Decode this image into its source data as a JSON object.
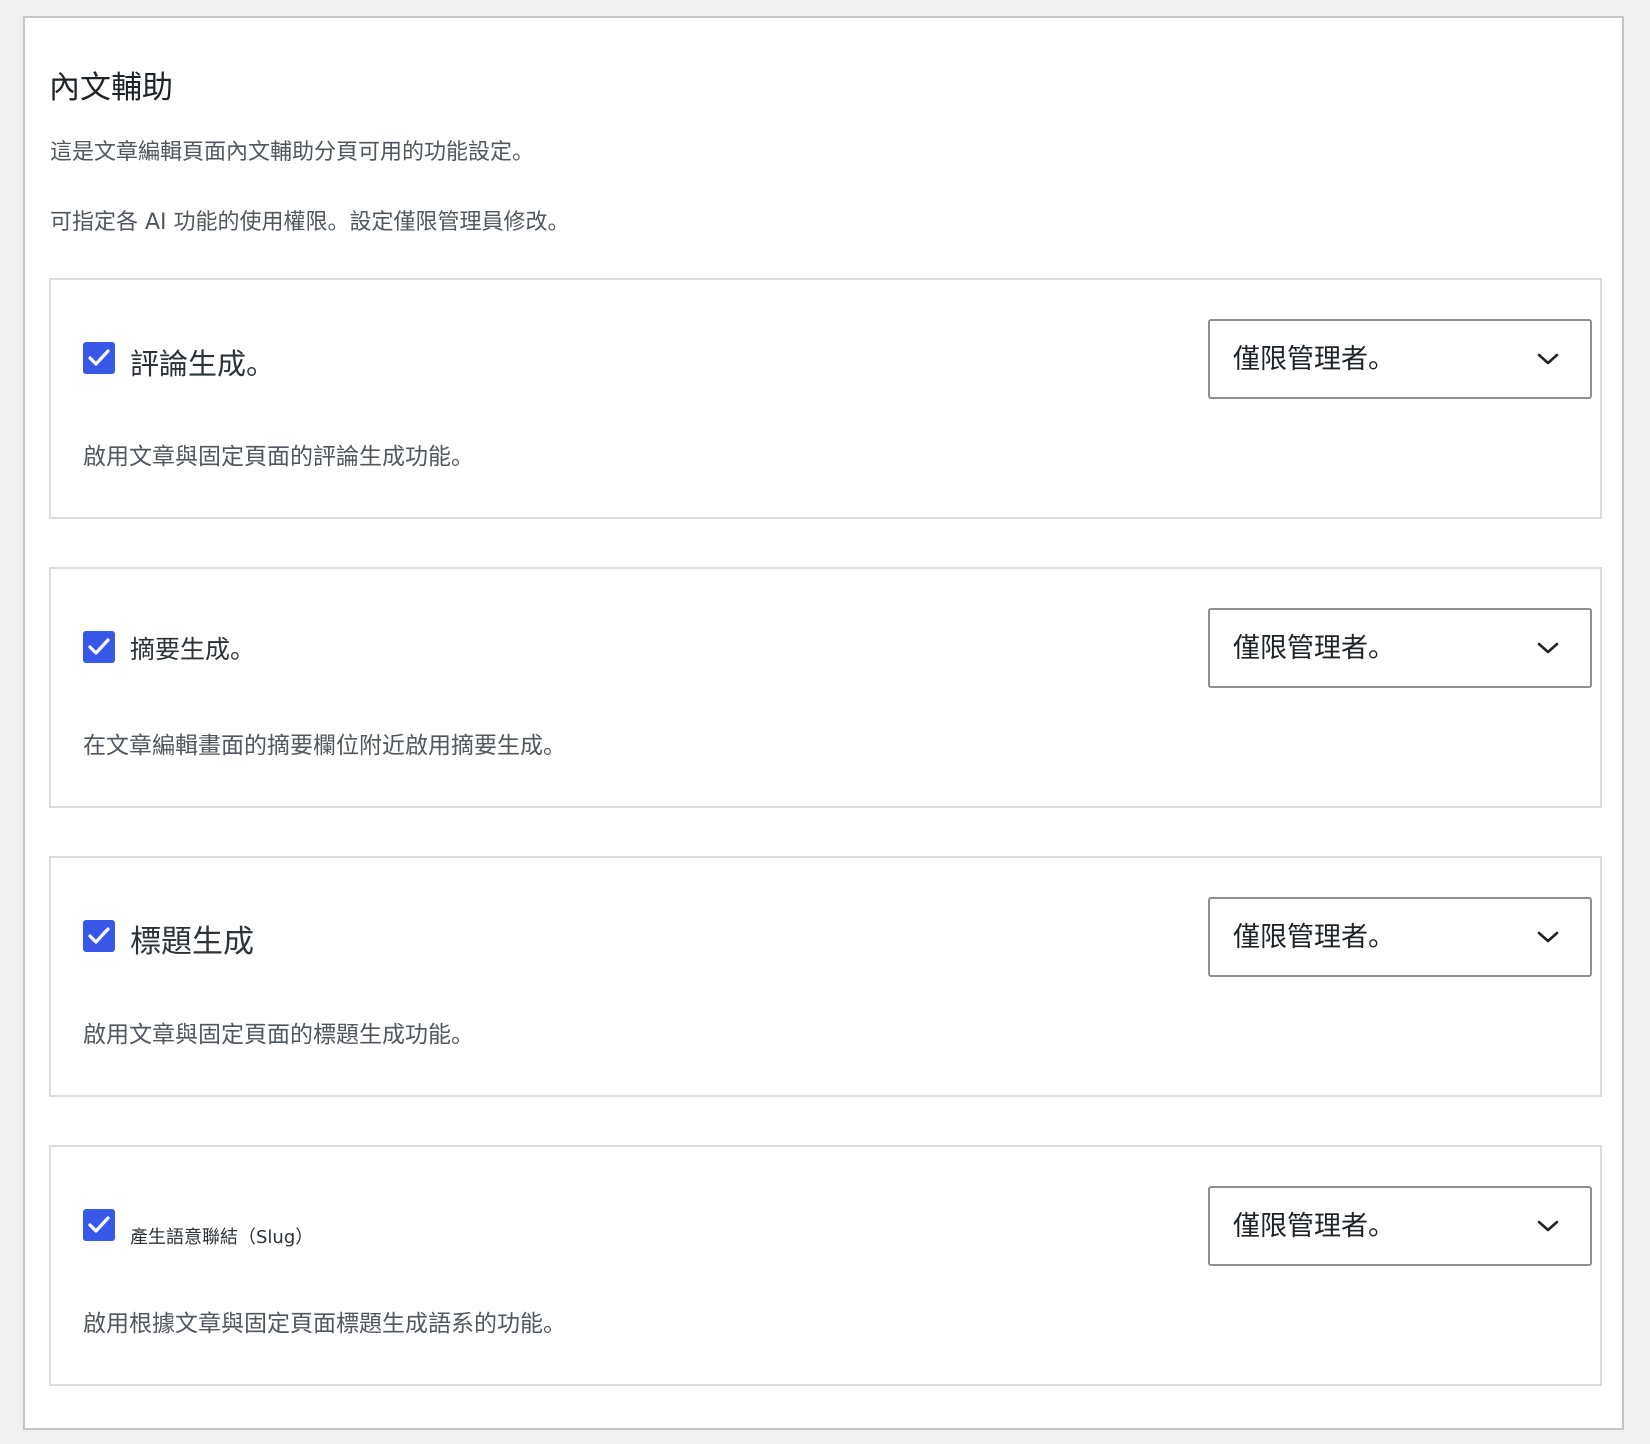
{
  "settings": {
    "title": "內文輔助",
    "description_1": "這是文章編輯頁面內文輔助分頁可用的功能設定。",
    "description_2": "可指定各 AI 功能的使用權限。設定僅限管理員修改。"
  },
  "features": [
    {
      "label": "評論生成。",
      "checked": true,
      "permission": "僅限管理者。",
      "description": "啟用文章與固定頁面的評論生成功能。"
    },
    {
      "label": "摘要生成。",
      "checked": true,
      "permission": "僅限管理者。",
      "description": "在文章編輯畫面的摘要欄位附近啟用摘要生成。"
    },
    {
      "label": "標題生成",
      "checked": true,
      "permission": "僅限管理者。",
      "description": "啟用文章與固定頁面的標題生成功能。"
    },
    {
      "label": "產生語意聯結（Slug）",
      "checked": true,
      "permission": "僅限管理者。",
      "description": "啟用根據文章與固定頁面標題生成語系的功能。"
    }
  ],
  "colors": {
    "checkbox": "#3858e9",
    "page_background": "#f0f0f1",
    "panel_background": "#ffffff"
  },
  "icons": {
    "checkbox": "checkmark-icon",
    "select": "chevron-down-icon"
  }
}
